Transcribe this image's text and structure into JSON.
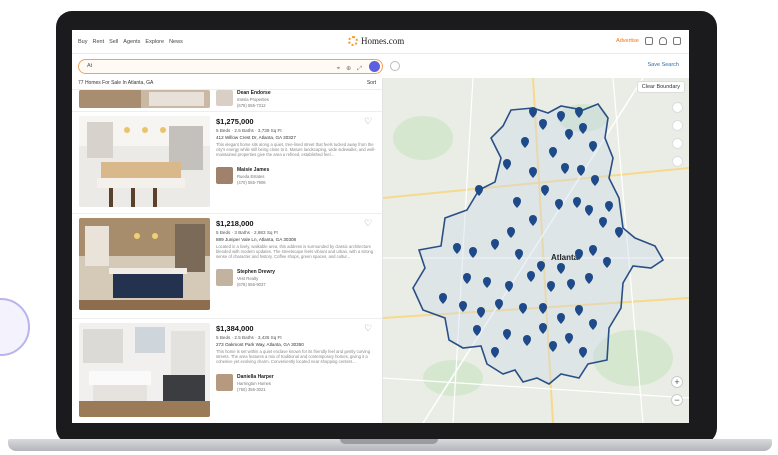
{
  "nav": {
    "items": [
      "Buy",
      "Rent",
      "Sell",
      "Agents",
      "Explore",
      "News"
    ]
  },
  "logo": {
    "text": "Homes.com"
  },
  "header": {
    "advertise": "Advertise"
  },
  "search": {
    "value": "At"
  },
  "save_search": "Save Search",
  "results": {
    "count_label": "77 Homes For Sale In Atlanta, GA",
    "sort_label": "Sort"
  },
  "map": {
    "clear_boundary": "Clear Boundary",
    "city_label": "Atlanta",
    "zoom_in": "+",
    "zoom_out": "−"
  },
  "top_partial": {
    "agent_name": "Dean Endorse",
    "agent_company": "Interia Properties",
    "agent_phone": "(678) 555-7312"
  },
  "listings": [
    {
      "price": "$1,275,000",
      "meta": "5 Beds · 2.5 Baths · 3,739 Sq Ft",
      "address": "412 Willow Crest Dr, Atlanta, GA 30327",
      "description": "This elegant home sits along a quiet, tree-lined street that feels tucked away from the city's energy while still being close to it. Mature landscaping, wide sidewalks, and well-maintained properties give the area a refined, established feel...",
      "agent_name": "Maisie James",
      "agent_company": "Rueda Estates",
      "agent_phone": "(470) 555-7906"
    },
    {
      "price": "$1,218,000",
      "meta": "5 Beds · 3 Baths · 2,983 Sq Ft",
      "address": "889 Juniper Vale Ln, Atlanta, GA 30308",
      "description": "Located in a lively, walkable area, this address is surrounded by classic architecture blended with modern updates. The streetscape feels vibrant and urban, with a strong sense of character and history. Coffee shops, green spaces, and cultur...",
      "agent_name": "Stephen Drewry",
      "agent_company": "Vest Realty",
      "agent_phone": "(678) 555-9037"
    },
    {
      "price": "$1,384,000",
      "meta": "5 Beds · 2.5 Baths · 3,436 Sq Ft",
      "address": "273 Oakmont Park Way, Atlanta, GA 30350",
      "description": "This home is set within a quiet enclave known for its friendly feel and gently curving streets. The area features a mix of traditional and contemporary homes, giving it a cohesive yet evolving charm. Conveniently located near shopping centers...",
      "agent_name": "Daniella Harper",
      "agent_company": "Harrington Homes",
      "agent_phone": "(750) 356-3021"
    }
  ],
  "colors": {
    "accent": "#e8741e",
    "pin": "#1f4a8a",
    "boundary": "#2a4f86",
    "search_go": "#5b5fe0"
  },
  "icons": [
    "map-pin-icon",
    "heart-icon",
    "search-icon",
    "chat-icon",
    "bell-icon",
    "grid-icon",
    "filter-icon",
    "layers-icon"
  ]
}
